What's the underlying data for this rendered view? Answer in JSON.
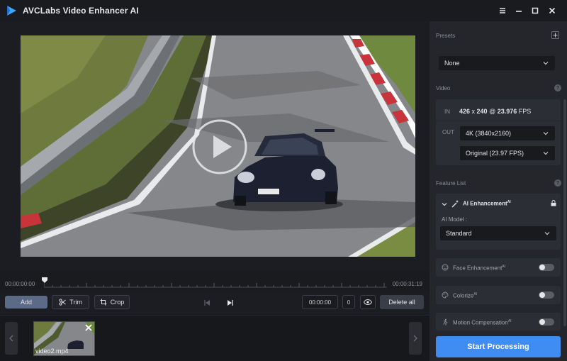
{
  "app": {
    "title": "AVCLabs Video Enhancer AI"
  },
  "timeline": {
    "start": "00:00:00:00",
    "end": "00:00:31:19"
  },
  "toolbar": {
    "add": "Add",
    "trim": "Trim",
    "crop": "Crop",
    "time_value": "00:00:00",
    "frame_value": "0",
    "delete_all": "Delete all"
  },
  "filmstrip": {
    "items": [
      {
        "name": "video2.mp4"
      }
    ]
  },
  "panel": {
    "presets": {
      "title": "Presets",
      "value": "None"
    },
    "video": {
      "title": "Video",
      "in_label": "IN",
      "in_res": "426",
      "in_x": " x ",
      "in_h": "240",
      "in_at": " @ ",
      "in_fps": "23.976",
      "in_fps_unit": " FPS",
      "out_label": "OUT",
      "resolution": "4K (3840x2160)",
      "fps": "Original (23.97 FPS)"
    },
    "feature_list": {
      "title": "Feature List",
      "ai_enhancement": {
        "label": "AI Enhancement",
        "sup": "AI",
        "model_label": "AI Model :",
        "model": "Standard"
      },
      "face": {
        "label": "Face Enhancement",
        "sup": "AI"
      },
      "colorize": {
        "label": "Colorize",
        "sup": "AI"
      },
      "motion": {
        "label": "Motion Compensation",
        "sup": "AI"
      }
    },
    "start_button": "Start Processing"
  },
  "colors": {
    "accent": "#3f8df2",
    "panel_bg": "#24262c",
    "main_bg": "#1c1d22"
  }
}
